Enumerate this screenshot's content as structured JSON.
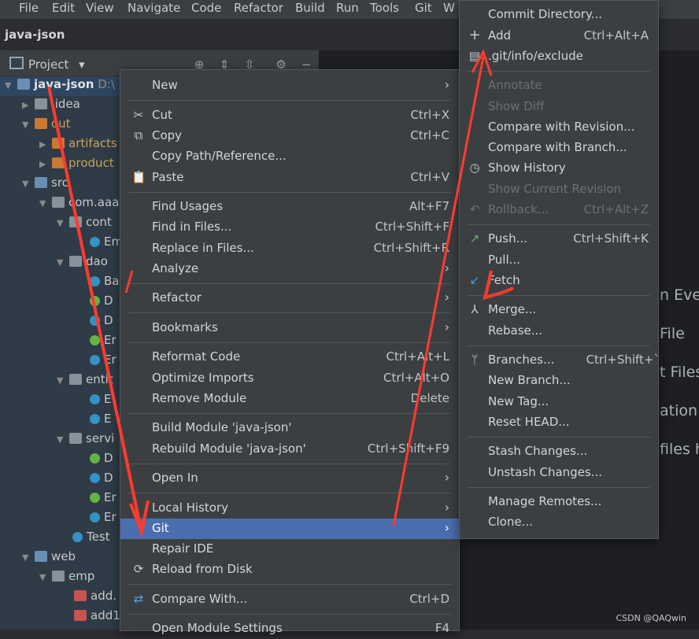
{
  "menubar": [
    "File",
    "Edit",
    "View",
    "Navigate",
    "Code",
    "Refactor",
    "Build",
    "Run",
    "Tools",
    "Git",
    "W"
  ],
  "project_title": "java-json",
  "toolwindow": {
    "dropdown_label": "Project",
    "dropdown_arrow": "▾"
  },
  "tree": [
    {
      "label": "java-json",
      "suffix": "D:\\"
    },
    {
      "label": ".idea"
    },
    {
      "label": "out"
    },
    {
      "label": "artifacts"
    },
    {
      "label": "product"
    },
    {
      "label": "src"
    },
    {
      "label": "com.aaa"
    },
    {
      "label": "cont"
    },
    {
      "label": "Em"
    },
    {
      "label": "dao"
    },
    {
      "label": "Ba"
    },
    {
      "label": "D"
    },
    {
      "label": "D"
    },
    {
      "label": "Er"
    },
    {
      "label": "Er"
    },
    {
      "label": "entit"
    },
    {
      "label": "E"
    },
    {
      "label": "E"
    },
    {
      "label": "servi"
    },
    {
      "label": "D"
    },
    {
      "label": "D"
    },
    {
      "label": "Er"
    },
    {
      "label": "Er"
    },
    {
      "label": "Test"
    },
    {
      "label": "web"
    },
    {
      "label": "emp"
    },
    {
      "label": "add."
    },
    {
      "label": "add1"
    }
  ],
  "editor_fragments": [
    "n Ever",
    "File",
    "t Files",
    "ation",
    "files h"
  ],
  "context_menu": {
    "items": [
      {
        "label": "New"
      },
      {
        "label": "Cut",
        "shortcut": "Ctrl+X",
        "icon": "cut-icon"
      },
      {
        "label": "Copy",
        "shortcut": "Ctrl+C",
        "icon": "copy-icon"
      },
      {
        "label": "Copy Path/Reference..."
      },
      {
        "label": "Paste",
        "shortcut": "Ctrl+V",
        "icon": "paste-icon"
      },
      {
        "label": "Find Usages",
        "shortcut": "Alt+F7"
      },
      {
        "label": "Find in Files...",
        "shortcut": "Ctrl+Shift+F"
      },
      {
        "label": "Replace in Files...",
        "shortcut": "Ctrl+Shift+R"
      },
      {
        "label": "Analyze"
      },
      {
        "label": "Refactor"
      },
      {
        "label": "Bookmarks"
      },
      {
        "label": "Reformat Code",
        "shortcut": "Ctrl+Alt+L"
      },
      {
        "label": "Optimize Imports",
        "shortcut": "Ctrl+Alt+O"
      },
      {
        "label": "Remove Module",
        "shortcut": "Delete"
      },
      {
        "label": "Build Module 'java-json'"
      },
      {
        "label": "Rebuild Module 'java-json'",
        "shortcut": "Ctrl+Shift+F9"
      },
      {
        "label": "Open In"
      },
      {
        "label": "Local History"
      },
      {
        "label": "Git"
      },
      {
        "label": "Repair IDE"
      },
      {
        "label": "Reload from Disk",
        "icon": "reload-icon"
      },
      {
        "label": "Compare With...",
        "shortcut": "Ctrl+D",
        "icon": "compare-icon"
      },
      {
        "label": "Open Module Settings",
        "shortcut": "F4"
      }
    ]
  },
  "git_menu": {
    "items": [
      {
        "label": "Commit Directory..."
      },
      {
        "label": "Add",
        "shortcut": "Ctrl+Alt+A",
        "icon": "plus-icon"
      },
      {
        "label": ".git/info/exclude",
        "icon": "file-icon"
      },
      {
        "label": "Annotate"
      },
      {
        "label": "Show Diff"
      },
      {
        "label": "Compare with Revision..."
      },
      {
        "label": "Compare with Branch..."
      },
      {
        "label": "Show History",
        "icon": "clock-icon"
      },
      {
        "label": "Show Current Revision"
      },
      {
        "label": "Rollback...",
        "shortcut": "Ctrl+Alt+Z",
        "icon": "rollback-icon"
      },
      {
        "label": "Push...",
        "shortcut": "Ctrl+Shift+K",
        "icon": "push-icon"
      },
      {
        "label": "Pull..."
      },
      {
        "label": "Fetch",
        "icon": "fetch-icon"
      },
      {
        "label": "Merge...",
        "icon": "merge-icon"
      },
      {
        "label": "Rebase..."
      },
      {
        "label": "Branches...",
        "shortcut": "Ctrl+Shift+`",
        "icon": "branch-icon"
      },
      {
        "label": "New Branch..."
      },
      {
        "label": "New Tag..."
      },
      {
        "label": "Reset HEAD..."
      },
      {
        "label": "Stash Changes..."
      },
      {
        "label": "Unstash Changes..."
      },
      {
        "label": "Manage Remotes..."
      },
      {
        "label": "Clone..."
      }
    ]
  },
  "watermark": "CSDN @QAQwin",
  "colors": {
    "highlight": "#4b6eaf",
    "annotation": "#ff3b30"
  }
}
